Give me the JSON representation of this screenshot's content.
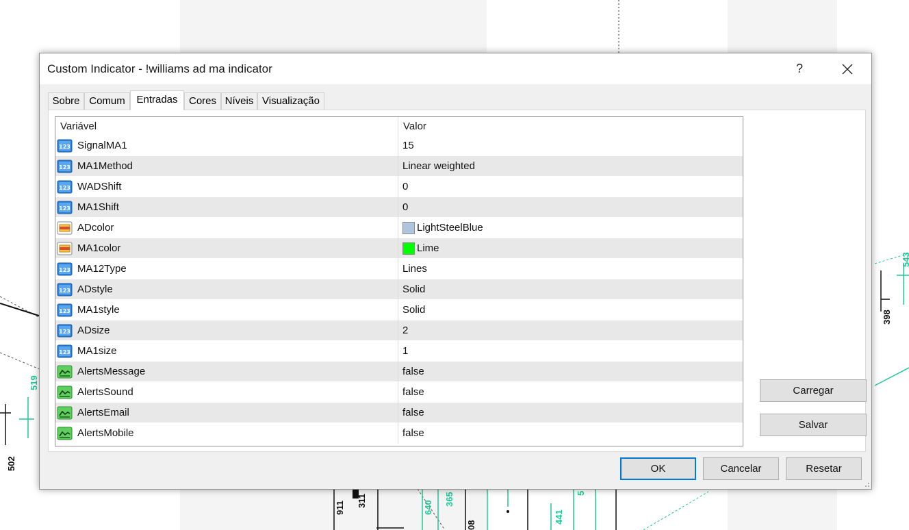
{
  "window": {
    "title": "Custom Indicator - !williams ad ma indicator",
    "help_label": "?",
    "close_label": "✕"
  },
  "tabs": [
    {
      "label": "Sobre"
    },
    {
      "label": "Comum"
    },
    {
      "label": "Entradas",
      "active": true
    },
    {
      "label": "Cores"
    },
    {
      "label": "Níveis"
    },
    {
      "label": "Visualização"
    }
  ],
  "table": {
    "headers": {
      "variable": "Variável",
      "value": "Valor"
    },
    "rows": [
      {
        "name": "SignalMA1",
        "value": "15",
        "icon": "int-icon"
      },
      {
        "name": "MA1Method",
        "value": "Linear weighted",
        "icon": "int-icon"
      },
      {
        "name": "WADShift",
        "value": "0",
        "icon": "int-icon"
      },
      {
        "name": "MA1Shift",
        "value": "0",
        "icon": "int-icon"
      },
      {
        "name": "ADcolor",
        "value": "LightSteelBlue",
        "icon": "color-icon",
        "swatch": "#b0c4de"
      },
      {
        "name": "MA1color",
        "value": "Lime",
        "icon": "color-icon",
        "swatch": "#00ff00"
      },
      {
        "name": "MA12Type",
        "value": "Lines",
        "icon": "int-icon"
      },
      {
        "name": "ADstyle",
        "value": "Solid",
        "icon": "int-icon"
      },
      {
        "name": "MA1style",
        "value": "Solid",
        "icon": "int-icon"
      },
      {
        "name": "ADsize",
        "value": "2",
        "icon": "int-icon"
      },
      {
        "name": "MA1size",
        "value": "1",
        "icon": "int-icon"
      },
      {
        "name": "AlertsMessage",
        "value": "false",
        "icon": "bool-icon"
      },
      {
        "name": "AlertsSound",
        "value": "false",
        "icon": "bool-icon"
      },
      {
        "name": "AlertsEmail",
        "value": "false",
        "icon": "bool-icon"
      },
      {
        "name": "AlertsMobile",
        "value": "false",
        "icon": "bool-icon"
      }
    ]
  },
  "buttons": {
    "load": "Carregar",
    "save": "Salvar",
    "ok": "OK",
    "cancel": "Cancelar",
    "reset": "Resetar"
  },
  "background_chart": {
    "labels": [
      "519",
      "502",
      "911",
      "311",
      "640",
      "365",
      "08",
      "441",
      "5",
      "398",
      "543"
    ]
  },
  "colors": {
    "accent": "#0078d7",
    "chart_green": "#1ec896",
    "row_alt": "#e8e8e8"
  }
}
